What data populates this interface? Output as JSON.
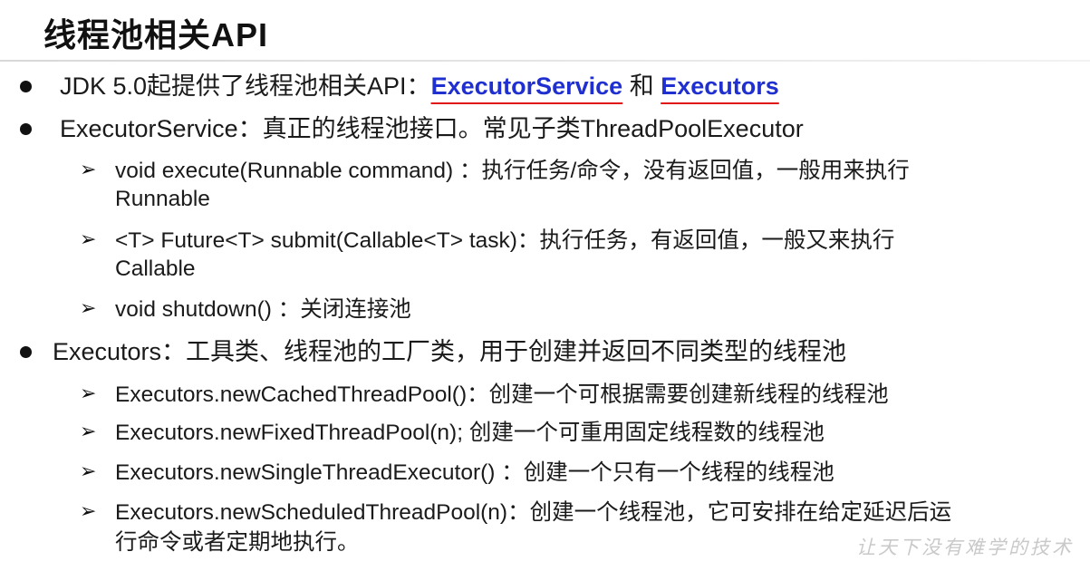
{
  "title": "线程池相关API",
  "items": [
    {
      "lead": "JDK 5.0起提供了线程池相关API：",
      "hl1": "ExecutorService",
      "conj": " 和 ",
      "hl2": "Executors"
    },
    {
      "text": "ExecutorService：真正的线程池接口。常见子类ThreadPoolExecutor",
      "subs": [
        {
          "line1": "void execute(Runnable command) ：执行任务/命令，没有返回值，一般用来执行",
          "line2": "Runnable"
        },
        {
          "line1": "<T> Future<T> submit(Callable<T> task)：执行任务，有返回值，一般又来执行",
          "line2": "Callable"
        },
        {
          "line1": "void shutdown() ：关闭连接池"
        }
      ]
    },
    {
      "text": "Executors：工具类、线程池的工厂类，用于创建并返回不同类型的线程池",
      "subs": [
        {
          "line1": "Executors.newCachedThreadPool()：创建一个可根据需要创建新线程的线程池"
        },
        {
          "line1": "Executors.newFixedThreadPool(n); 创建一个可重用固定线程数的线程池"
        },
        {
          "line1": "Executors.newSingleThreadExecutor() ：创建一个只有一个线程的线程池"
        },
        {
          "line1": "Executors.newScheduledThreadPool(n)：创建一个线程池，它可安排在给定延迟后运",
          "line2": "行命令或者定期地执行。"
        }
      ]
    }
  ],
  "watermark": "让天下没有难学的技术",
  "icons": {
    "bullet": "filled-circle-bullet",
    "arrow": "arrowhead-bullet"
  }
}
